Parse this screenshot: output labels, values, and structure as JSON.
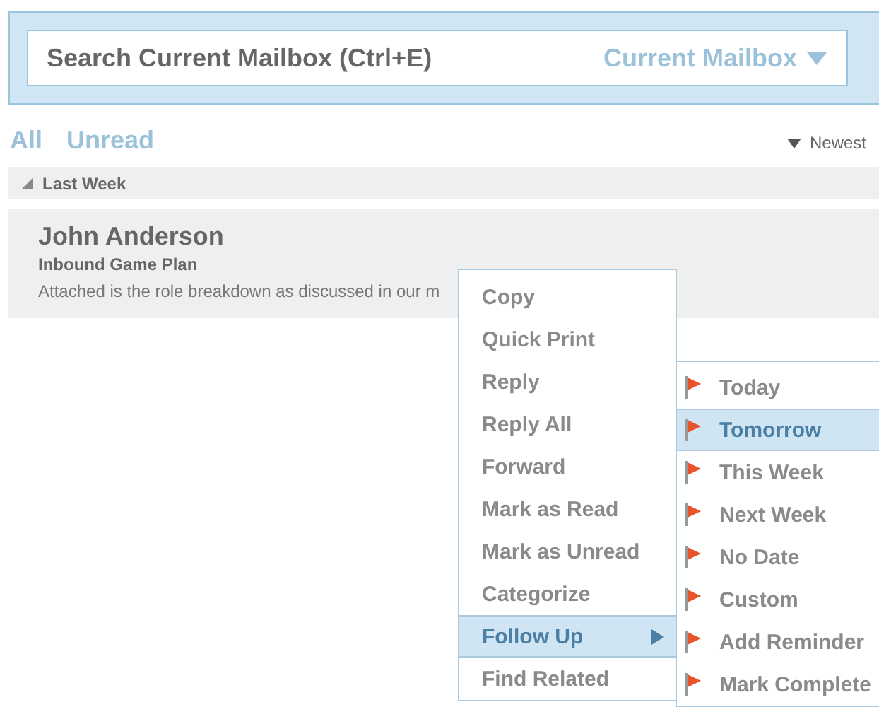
{
  "search": {
    "placeholder": "Search Current Mailbox (Ctrl+E)",
    "scope": "Current Mailbox"
  },
  "filters": [
    {
      "label": "All",
      "selected": false
    },
    {
      "label": "Unread",
      "selected": false
    }
  ],
  "sort": {
    "label": "Newest"
  },
  "group": {
    "label": "Last Week",
    "expanded": true
  },
  "message": {
    "sender": "John Anderson",
    "subject": "Inbound Game Plan",
    "preview": "Attached is the role breakdown as discussed in our m"
  },
  "context_menu": {
    "items": [
      {
        "label": "Copy",
        "selected": false,
        "submenu": false
      },
      {
        "label": "Quick Print",
        "selected": false,
        "submenu": false
      },
      {
        "label": "Reply",
        "selected": false,
        "submenu": false
      },
      {
        "label": "Reply All",
        "selected": false,
        "submenu": false
      },
      {
        "label": "Forward",
        "selected": false,
        "submenu": false
      },
      {
        "label": "Mark as Read",
        "selected": false,
        "submenu": false
      },
      {
        "label": "Mark as Unread",
        "selected": false,
        "submenu": false
      },
      {
        "label": "Categorize",
        "selected": false,
        "submenu": false
      },
      {
        "label": "Follow Up",
        "selected": true,
        "submenu": true
      },
      {
        "label": "Find Related",
        "selected": false,
        "submenu": false
      }
    ]
  },
  "submenu": {
    "items": [
      {
        "label": "Today",
        "selected": false
      },
      {
        "label": "Tomorrow",
        "selected": true
      },
      {
        "label": "This Week",
        "selected": false
      },
      {
        "label": "Next Week",
        "selected": false
      },
      {
        "label": "No Date",
        "selected": false
      },
      {
        "label": "Custom",
        "selected": false
      },
      {
        "label": "Add Reminder",
        "selected": false
      },
      {
        "label": "Mark Complete",
        "selected": false
      }
    ]
  }
}
